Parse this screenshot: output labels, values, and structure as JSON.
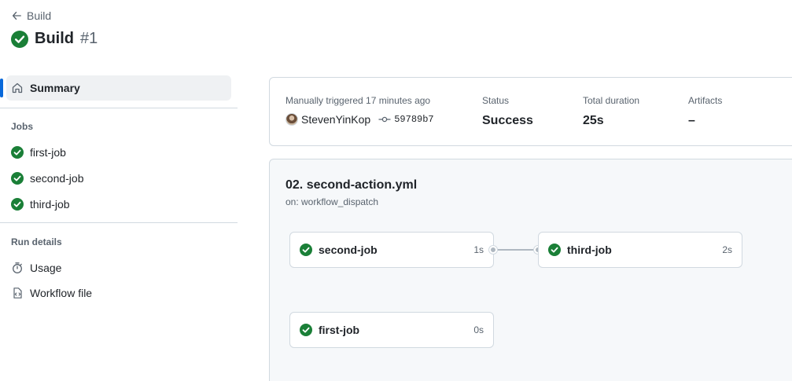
{
  "header": {
    "back_label": "Build",
    "run_name": "Build",
    "run_number": "#1"
  },
  "sidebar": {
    "summary_label": "Summary",
    "jobs_heading": "Jobs",
    "jobs": [
      {
        "label": "first-job",
        "status": "success"
      },
      {
        "label": "second-job",
        "status": "success"
      },
      {
        "label": "third-job",
        "status": "success"
      }
    ],
    "run_details_heading": "Run details",
    "run_details": [
      {
        "label": "Usage",
        "icon": "stopwatch-icon"
      },
      {
        "label": "Workflow file",
        "icon": "file-code-icon"
      }
    ]
  },
  "summary": {
    "trigger_text": "Manually triggered 17 minutes ago",
    "actor": "StevenYinKop",
    "commit": "59789b7",
    "status_label": "Status",
    "status_value": "Success",
    "duration_label": "Total duration",
    "duration_value": "25s",
    "artifacts_label": "Artifacts",
    "artifacts_value": "–"
  },
  "workflow": {
    "title": "02. second-action.yml",
    "trigger": "on: workflow_dispatch",
    "jobs": [
      {
        "name": "second-job",
        "duration": "1s"
      },
      {
        "name": "third-job",
        "duration": "2s"
      },
      {
        "name": "first-job",
        "duration": "0s"
      }
    ]
  },
  "colors": {
    "success": "#1a7f37",
    "accent": "#0969da",
    "border": "#d1d9e0"
  }
}
